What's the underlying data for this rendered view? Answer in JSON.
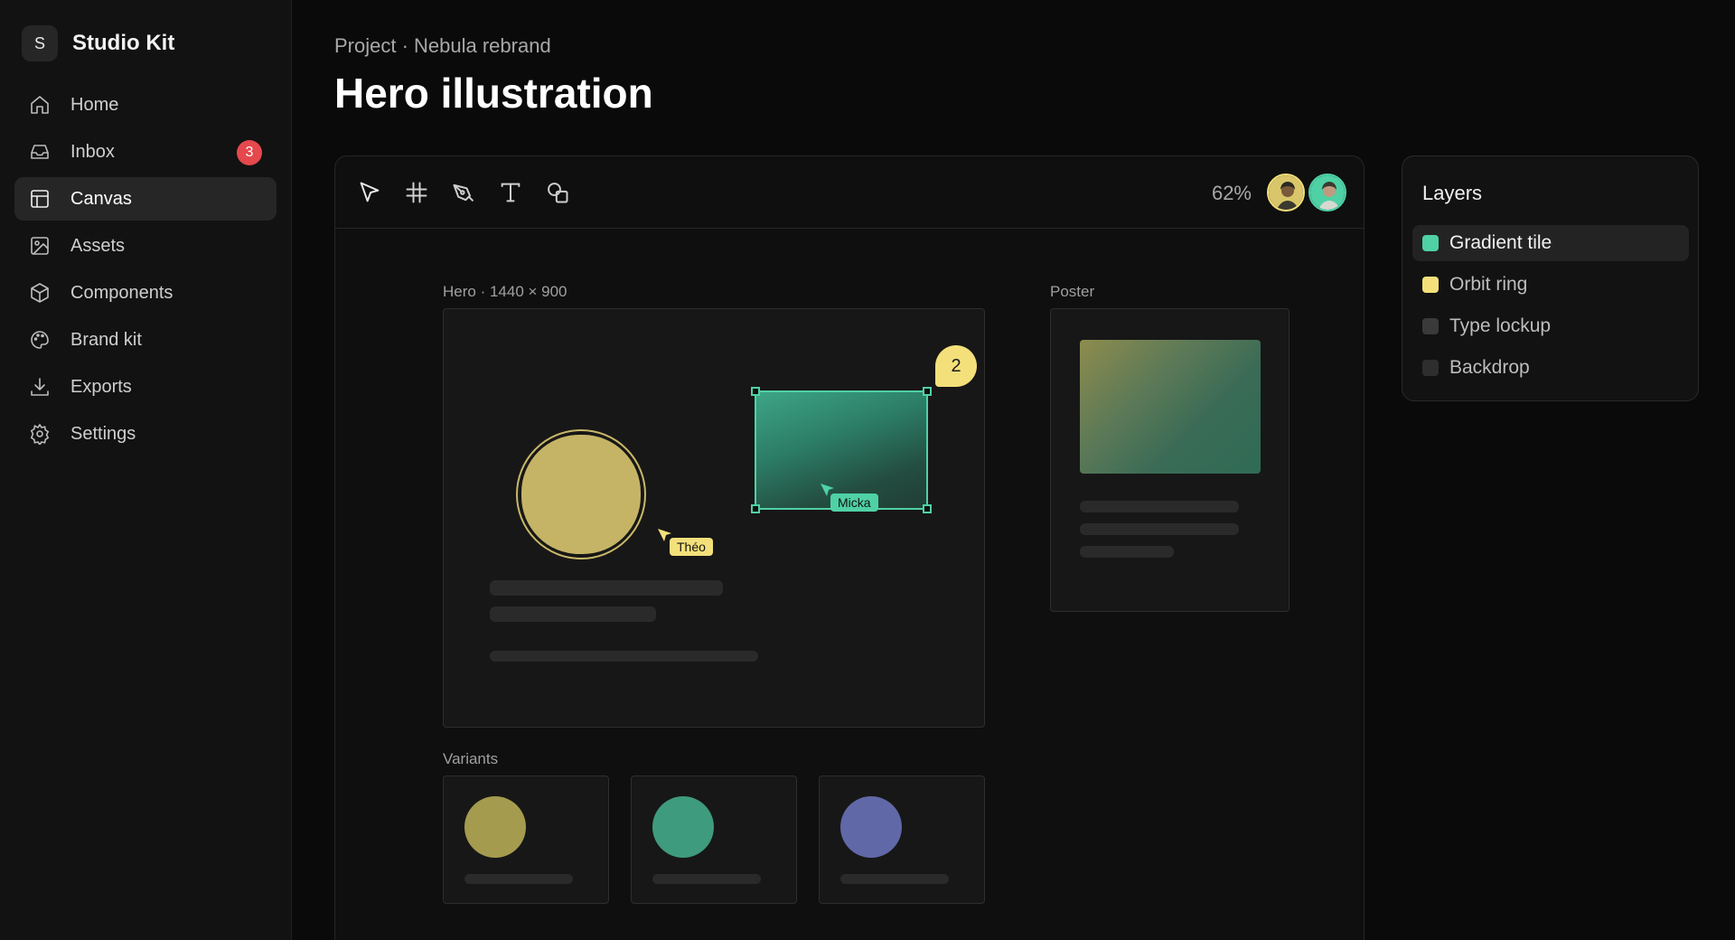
{
  "brand": {
    "logo_letter": "S",
    "name": "Studio Kit"
  },
  "nav": {
    "items": [
      {
        "label": "Home",
        "icon": "home-icon"
      },
      {
        "label": "Inbox",
        "icon": "inbox-icon",
        "badge": "3"
      },
      {
        "label": "Canvas",
        "icon": "canvas-icon",
        "active": true
      },
      {
        "label": "Assets",
        "icon": "image-icon"
      },
      {
        "label": "Components",
        "icon": "cube-icon"
      },
      {
        "label": "Brand kit",
        "icon": "palette-icon"
      },
      {
        "label": "Exports",
        "icon": "download-icon"
      },
      {
        "label": "Settings",
        "icon": "gear-icon"
      }
    ]
  },
  "header": {
    "breadcrumb": "Project · Nebula rebrand",
    "title": "Hero illustration"
  },
  "toolbar": {
    "tools": [
      "select-tool-icon",
      "frame-tool-icon",
      "pen-tool-icon",
      "text-tool-icon",
      "shapes-tool-icon"
    ],
    "zoom": "62%"
  },
  "canvas": {
    "hero_label": "Hero · 1440 × 900",
    "poster_label": "Poster",
    "variants_label": "Variants",
    "comment_count": "2",
    "cursors": [
      {
        "name": "Théo",
        "color": "#f4e07a"
      },
      {
        "name": "Micka",
        "color": "#4fd1a5"
      }
    ],
    "variant_colors": [
      "#a59b4e",
      "#3f9b7e",
      "#6168a8"
    ]
  },
  "layers": {
    "title": "Layers",
    "items": [
      {
        "label": "Gradient tile",
        "color": "#4fd1a5",
        "active": true
      },
      {
        "label": "Orbit ring",
        "color": "#f4e07a"
      },
      {
        "label": "Type lockup",
        "color": "#3a3a3a"
      },
      {
        "label": "Backdrop",
        "color": "#2e2e2e"
      }
    ]
  },
  "colors": {
    "accent": "#4fd1a5",
    "highlight": "#f4e07a",
    "badge": "#e5484d"
  }
}
